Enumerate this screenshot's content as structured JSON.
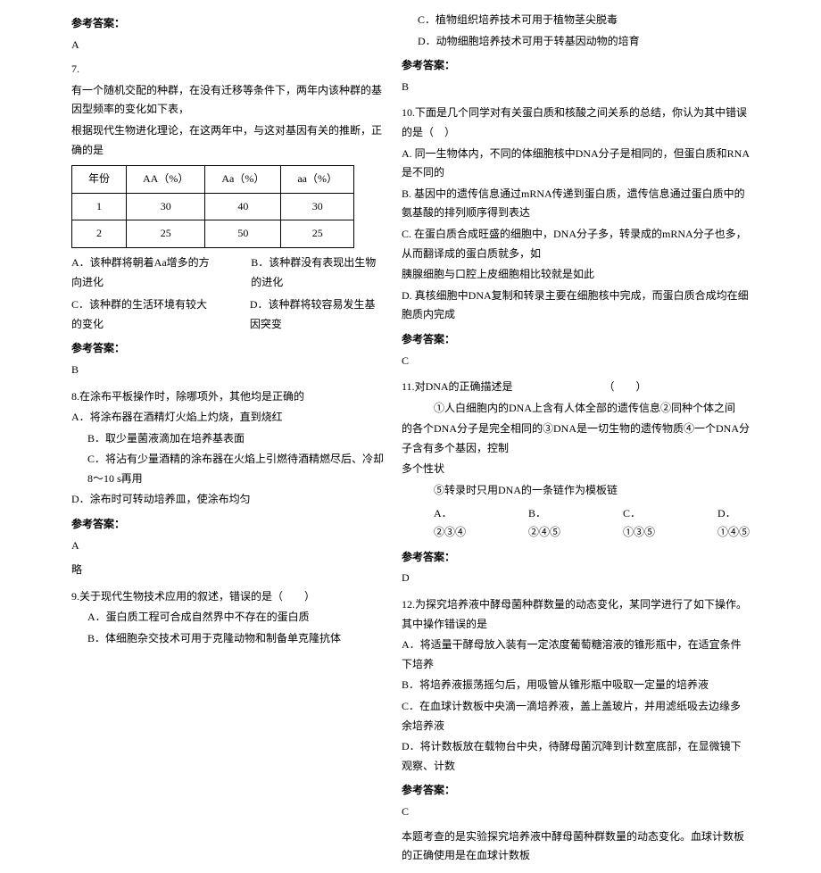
{
  "left": {
    "ans_label": "参考答案：",
    "ans6": "A",
    "q7": {
      "num": "7.",
      "text1": "有一个随机交配的种群，在没有迁移等条件下，两年内该种群的基因型频率的变化如下表，",
      "text2": "根据现代生物进化理论，在这两年中，与这对基因有关的推断，正确的是",
      "table": {
        "headers": [
          "年份",
          "AA（%）",
          "Aa（%）",
          "aa（%）"
        ],
        "rows": [
          [
            "1",
            "30",
            "40",
            "30"
          ],
          [
            "2",
            "25",
            "50",
            "25"
          ]
        ]
      },
      "optA": "A．该种群将朝着Aa增多的方向进化",
      "optB": "B．该种群没有表现出生物的进化",
      "optC": "C．该种群的生活环境有较大的变化",
      "optD": "D．该种群将较容易发生基因突变",
      "ans": "B"
    },
    "q8": {
      "num": "8.",
      "stem": "在涂布平板操作时，除哪项外，其他均是正确的",
      "optA": "A．将涂布器在酒精灯火焰上灼烧，直到烧红",
      "optB": "B．取少量菌液滴加在培养基表面",
      "optC": "C．将沾有少量酒精的涂布器在火焰上引燃待酒精燃尽后、冷却8～10 s再用",
      "optD": "D．涂布时可转动培养皿，使涂布均匀",
      "ans": "A",
      "note": "略"
    },
    "q9": {
      "num": "9.",
      "stem": "关于现代生物技术应用的叙述，错误的是（　　）",
      "optA": "A．蛋白质工程可合成自然界中不存在的蛋白质",
      "optB": "B．体细胞杂交技术可用于克隆动物和制备单克隆抗体"
    }
  },
  "right": {
    "q9cont": {
      "optC": "C．植物组织培养技术可用于植物茎尖脱毒",
      "optD": "D．动物细胞培养技术可用于转基因动物的培育",
      "ans": "B"
    },
    "ans_label": "参考答案：",
    "q10": {
      "num": "10.",
      "stem": "下面是几个同学对有关蛋白质和核酸之间关系的总结，你认为其中错误的是（　）",
      "optA": "A. 同一生物体内，不同的体细胞核中DNA分子是相同的，但蛋白质和RNA是不同的",
      "optB": "B. 基因中的遗传信息通过mRNA传递到蛋白质，遗传信息通过蛋白质中的氨基酸的排列顺序得到表达",
      "optC1": "C. 在蛋白质合成旺盛的细胞中，DNA分子多，转录成的mRNA分子也多，从而翻译成的蛋白质就多，如",
      "optC2": "胰腺细胞与口腔上皮细胞相比较就是如此",
      "optD": "D. 真核细胞中DNA复制和转录主要在细胞核中完成，而蛋白质合成均在细胞质内完成",
      "ans": "C"
    },
    "q11": {
      "num": "11.",
      "stem": "对DNA的正确描述是　　　　　　　　　（　　）",
      "line1": "①人白细胞内的DNA上含有人体全部的遗传信息②同种个体之间",
      "line2": "的各个DNA分子是完全相同的③DNA是一切生物的遗传物质④一个DNA分子含有多个基因，控制",
      "line3": "多个性状",
      "line4": "⑤转录时只用DNA的一条链作为模板链",
      "optA": "A．②③④",
      "optB": "B．②④⑤",
      "optC": "C．①③⑤",
      "optD": "D．①④⑤",
      "ans": "D"
    },
    "q12": {
      "num": "12.",
      "stem": "为探究培养液中酵母菌种群数量的动态变化，某同学进行了如下操作。其中操作错误的是",
      "optA": "A．将适量干酵母放入装有一定浓度葡萄糖溶液的锥形瓶中，在适宜条件下培养",
      "optB": "B．将培养液振荡摇匀后，用吸管从锥形瓶中吸取一定量的培养液",
      "optC": "C．在血球计数板中央滴一滴培养液，盖上盖玻片，并用滤纸吸去边缘多余培养液",
      "optD": "D．将计数板放在载物台中央，待酵母菌沉降到计数室底部，在显微镜下观察、计数",
      "ans": "C",
      "exp": "本题考查的是实验探究培养液中酵母菌种群数量的动态变化。血球计数板的正确使用是在血球计数板"
    }
  }
}
